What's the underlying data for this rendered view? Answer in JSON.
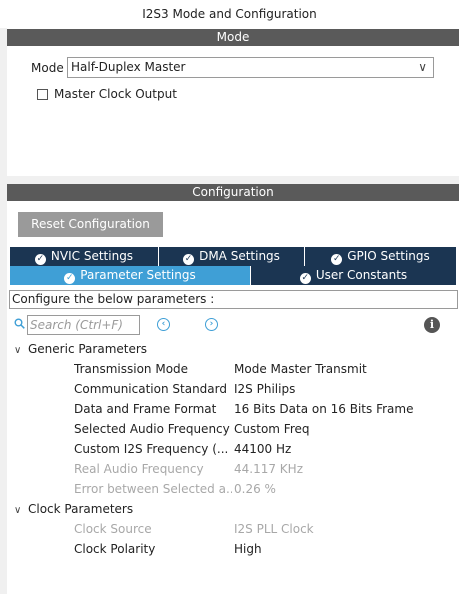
{
  "window_title": "I2S3 Mode and Configuration",
  "mode_section": {
    "header": "Mode",
    "mode_label": "Mode",
    "mode_value": "Half-Duplex Master",
    "master_clock_label": "Master Clock Output",
    "master_clock_checked": false
  },
  "config_section": {
    "header": "Configuration",
    "reset_button": "Reset Configuration",
    "tabs_row1": [
      {
        "label": "NVIC Settings"
      },
      {
        "label": "DMA Settings"
      },
      {
        "label": "GPIO Settings"
      }
    ],
    "tabs_row2": [
      {
        "label": "Parameter Settings",
        "active": true
      },
      {
        "label": "User Constants",
        "active": false
      }
    ],
    "description": "Configure the below parameters :",
    "search_placeholder": "Search (Ctrl+F)",
    "groups": [
      {
        "label": "Generic Parameters",
        "params": [
          {
            "name": "Transmission Mode",
            "value": "Mode Master Transmit",
            "enabled": true
          },
          {
            "name": "Communication Standard",
            "value": "I2S Philips",
            "enabled": true
          },
          {
            "name": "Data and Frame Format",
            "value": "16 Bits Data on 16 Bits Frame",
            "enabled": true
          },
          {
            "name": "Selected Audio Frequency",
            "value": "Custom Freq",
            "enabled": true
          },
          {
            "name": "Custom I2S Frequency (...",
            "value": "44100 Hz",
            "enabled": true
          },
          {
            "name": "Real Audio Frequency",
            "value": "44.117 KHz",
            "enabled": false
          },
          {
            "name": "Error between Selected a...",
            "value": "0.26 %",
            "enabled": false
          }
        ]
      },
      {
        "label": "Clock Parameters",
        "params": [
          {
            "name": "Clock Source",
            "value": "I2S PLL Clock",
            "enabled": false
          },
          {
            "name": "Clock Polarity",
            "value": "High",
            "enabled": true
          }
        ]
      }
    ]
  },
  "colors": {
    "section_bar": "#5a5a5a",
    "tab_dark": "#1b3552",
    "tab_active": "#3f9fd6",
    "disabled_text": "#a8a8a8"
  }
}
